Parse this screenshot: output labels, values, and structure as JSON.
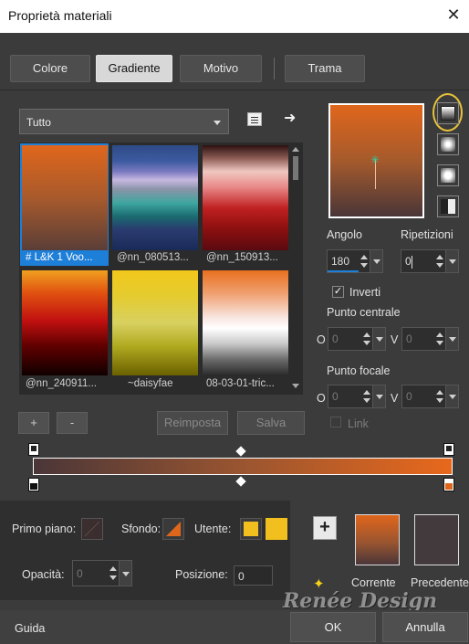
{
  "window": {
    "title": "Proprietà materiali",
    "close_icon": "close-icon"
  },
  "tabs": [
    {
      "label": "Colore",
      "active": false
    },
    {
      "label": "Gradiente",
      "active": true
    },
    {
      "label": "Motivo",
      "active": false
    },
    {
      "label": "Trama",
      "active": false
    }
  ],
  "category_select": {
    "value": "Tutto"
  },
  "gallery": {
    "items": [
      {
        "label": "# L&K 1 Voo...",
        "selected": true
      },
      {
        "label": "@nn_080513...",
        "selected": false
      },
      {
        "label": "@nn_150913...",
        "selected": false
      },
      {
        "label": "@nn_240911...",
        "selected": false
      },
      {
        "label": "~daisyfae",
        "selected": false
      },
      {
        "label": "08-03-01-tric...",
        "selected": false
      }
    ]
  },
  "gallery_buttons": {
    "add": "+",
    "remove": "-",
    "reset": "Reimposta",
    "save": "Salva"
  },
  "gradient_settings": {
    "angle_label": "Angolo",
    "angle_value": "180",
    "repeats_label": "Ripetizioni",
    "repeats_value": "0",
    "invert_label": "Inverti",
    "invert_checked": true,
    "center_label": "Punto centrale",
    "center_h_label": "O",
    "center_h_value": "0",
    "center_v_label": "V",
    "center_v_value": "0",
    "focal_label": "Punto focale",
    "focal_h_label": "O",
    "focal_h_value": "0",
    "focal_v_label": "V",
    "focal_v_value": "0",
    "link_label": "Link"
  },
  "bottom": {
    "foreground_label": "Primo piano:",
    "background_label": "Sfondo:",
    "user_label": "Utente:",
    "opacity_label": "Opacità:",
    "opacity_value": "0",
    "position_label": "Posizione:",
    "position_value": "0",
    "current_label": "Corrente",
    "previous_label": "Precedente",
    "add_icon": "plus-icon"
  },
  "watermark": {
    "text": "Renée Design"
  },
  "footer": {
    "help": "Guida",
    "ok": "OK",
    "cancel": "Annulla"
  },
  "colors": {
    "gradient_top": "#e0661c",
    "gradient_bottom": "#4a3638",
    "user_swatch": "#f2c01e",
    "accent_blue": "#1e7fd8",
    "previous_swatch": "#423a3c"
  }
}
